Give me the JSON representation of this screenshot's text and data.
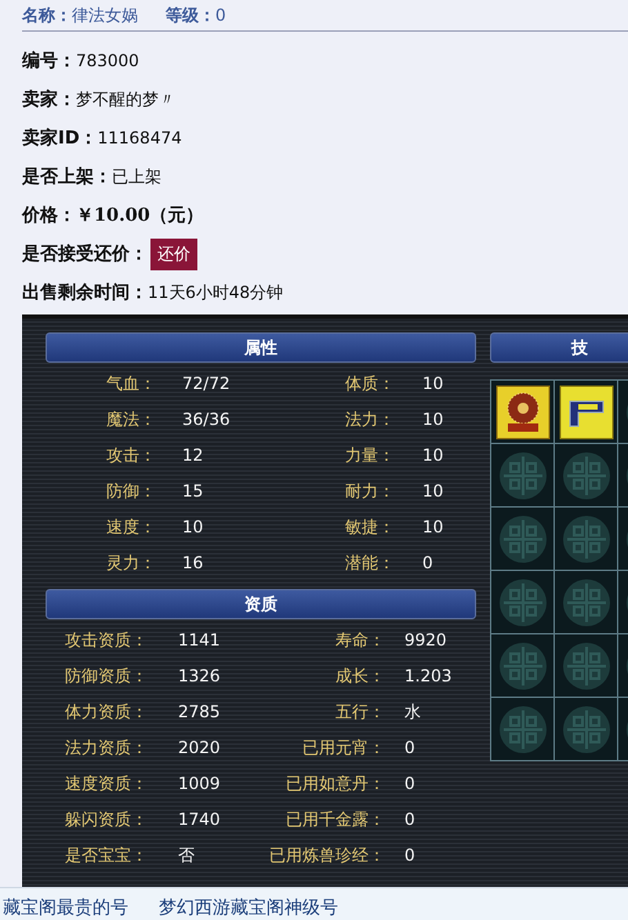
{
  "header": {
    "name_label": "名称：",
    "name": "律法女娲",
    "level_label": "等级：",
    "level": "0"
  },
  "fields": [
    {
      "label": "编号：",
      "value": "783000",
      "kind": "text"
    },
    {
      "label": "卖家：",
      "value": "梦不醒的梦〃",
      "kind": "text"
    },
    {
      "label": "卖家ID：",
      "value": "11168474",
      "kind": "text"
    },
    {
      "label": "是否上架：",
      "value": "已上架",
      "kind": "text"
    },
    {
      "label": "价格：",
      "value": "￥10.00（元）",
      "kind": "price"
    },
    {
      "label": "是否接受还价：",
      "value": "还价",
      "kind": "button"
    },
    {
      "label": "出售剩余时间：",
      "value": "11天6小时48分钟",
      "kind": "text"
    }
  ],
  "attributes": {
    "title": "属性",
    "rows": [
      {
        "left_label": "气血：",
        "left_value": "72/72",
        "right_label": "体质：",
        "right_value": "10"
      },
      {
        "left_label": "魔法：",
        "left_value": "36/36",
        "right_label": "法力：",
        "right_value": "10"
      },
      {
        "left_label": "攻击：",
        "left_value": "12",
        "right_label": "力量：",
        "right_value": "10"
      },
      {
        "left_label": "防御：",
        "left_value": "15",
        "right_label": "耐力：",
        "right_value": "10"
      },
      {
        "left_label": "速度：",
        "left_value": "10",
        "right_label": "敏捷：",
        "right_value": "10"
      },
      {
        "left_label": "灵力：",
        "left_value": "16",
        "right_label": "潜能：",
        "right_value": "0"
      }
    ]
  },
  "qualities": {
    "title": "资质",
    "rows": [
      {
        "left_label": "攻击资质：",
        "left_value": "1141",
        "right_label": "寿命：",
        "right_value": "9920"
      },
      {
        "left_label": "防御资质：",
        "left_value": "1326",
        "right_label": "成长：",
        "right_value": "1.203"
      },
      {
        "left_label": "体力资质：",
        "left_value": "2785",
        "right_label": "五行：",
        "right_value": "水"
      },
      {
        "left_label": "法力资质：",
        "left_value": "2020",
        "right_label": "已用元宵：",
        "right_value": "0"
      },
      {
        "left_label": "速度资质：",
        "left_value": "1009",
        "right_label": "已用如意丹：",
        "right_value": "0"
      },
      {
        "left_label": "躲闪资质：",
        "left_value": "1740",
        "right_label": "已用千金露：",
        "right_value": "0"
      },
      {
        "left_label": "是否宝宝：",
        "left_value": "否",
        "right_label": "已用炼兽珍经：",
        "right_value": "0"
      }
    ]
  },
  "skills": {
    "title": "技",
    "slots": [
      {
        "filled": true
      },
      {
        "filled": true
      },
      {
        "filled": false
      },
      {
        "filled": false
      },
      {
        "filled": false
      },
      {
        "filled": false
      },
      {
        "filled": false
      },
      {
        "filled": false
      },
      {
        "filled": false
      },
      {
        "filled": false
      },
      {
        "filled": false
      },
      {
        "filled": false
      },
      {
        "filled": false
      },
      {
        "filled": false
      },
      {
        "filled": false
      },
      {
        "filled": false
      },
      {
        "filled": false
      },
      {
        "filled": false
      }
    ]
  },
  "footer_links": [
    "藏宝阁最贵的号",
    "梦幻西游藏宝阁神级号"
  ]
}
